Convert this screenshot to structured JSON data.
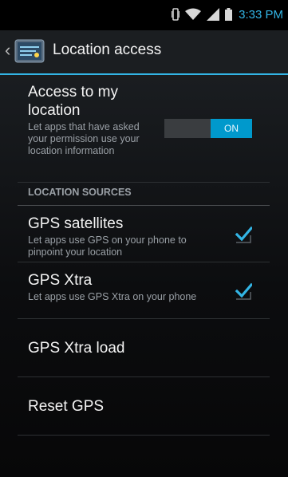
{
  "status_bar": {
    "time": "3:33 PM",
    "accent_color": "#33b5e5"
  },
  "action_bar": {
    "up_glyph": "‹",
    "title": "Location access"
  },
  "access": {
    "title": "Access to my location",
    "summary": "Let apps that have asked your permission use your location information",
    "toggle_label": "ON",
    "toggle_state": true
  },
  "section": {
    "header": "LOCATION SOURCES"
  },
  "items": [
    {
      "title": "GPS satellites",
      "summary": "Let apps use GPS on your phone to pinpoint your location",
      "checked": true
    },
    {
      "title": "GPS Xtra",
      "summary": "Let apps use GPS Xtra on your phone",
      "checked": true
    },
    {
      "title": "GPS Xtra load"
    },
    {
      "title": "Reset GPS"
    }
  ]
}
